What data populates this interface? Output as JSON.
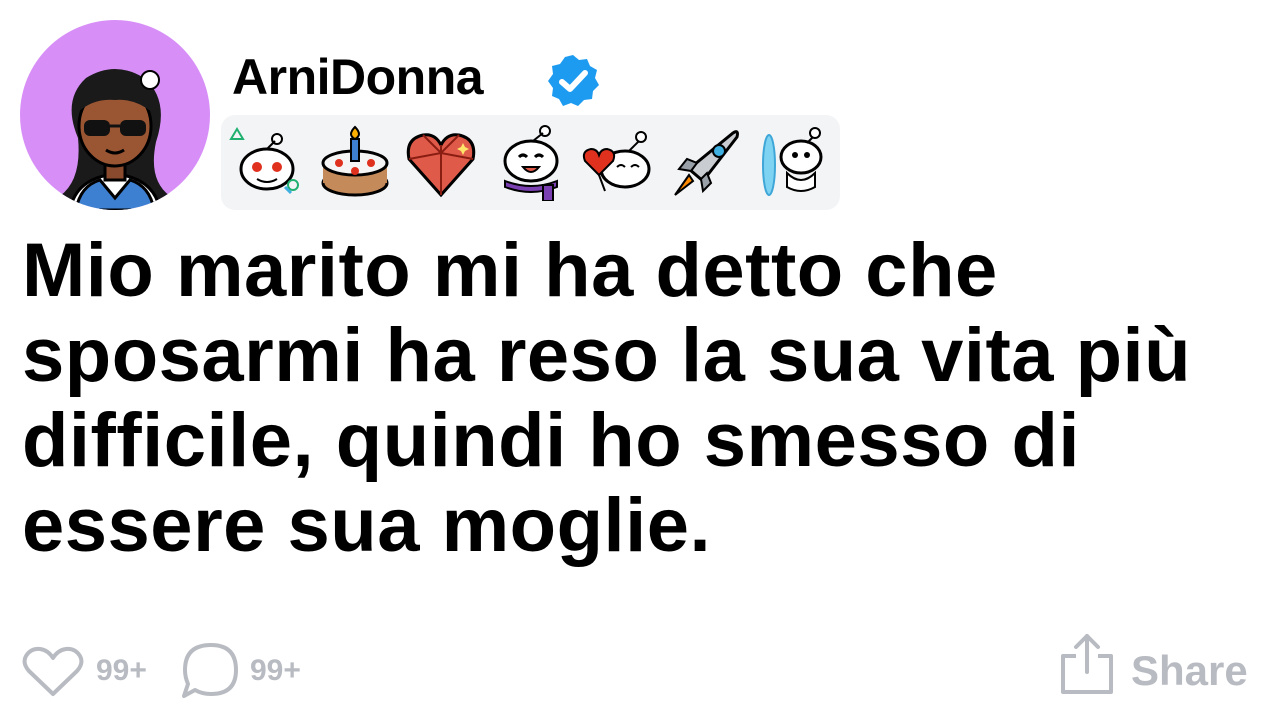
{
  "post": {
    "author": {
      "username": "ArniDonna",
      "verified": true,
      "avatar_icon": "avatar-icon"
    },
    "awards": [
      {
        "icon": "snoo-triangle-circle-award-icon"
      },
      {
        "icon": "birthday-cake-award-icon"
      },
      {
        "icon": "crystal-heart-award-icon"
      },
      {
        "icon": "snoo-scarf-tongue-award-icon"
      },
      {
        "icon": "snoo-heart-balloon-award-icon"
      },
      {
        "icon": "rocket-award-icon"
      },
      {
        "icon": "snoo-portal-award-icon"
      }
    ],
    "title": "Mio marito mi ha detto che sposarmi ha reso la sua vita più difficile, quindi ho smesso di essere sua moglie.",
    "actions": {
      "likes": "99+",
      "comments": "99+",
      "share_label": "Share"
    }
  },
  "colors": {
    "avatar_bg": "#d78ff7",
    "verified_badge": "#1d9bf0",
    "footer_gray": "#b8bbc1",
    "awards_bg": "#f3f4f6"
  }
}
